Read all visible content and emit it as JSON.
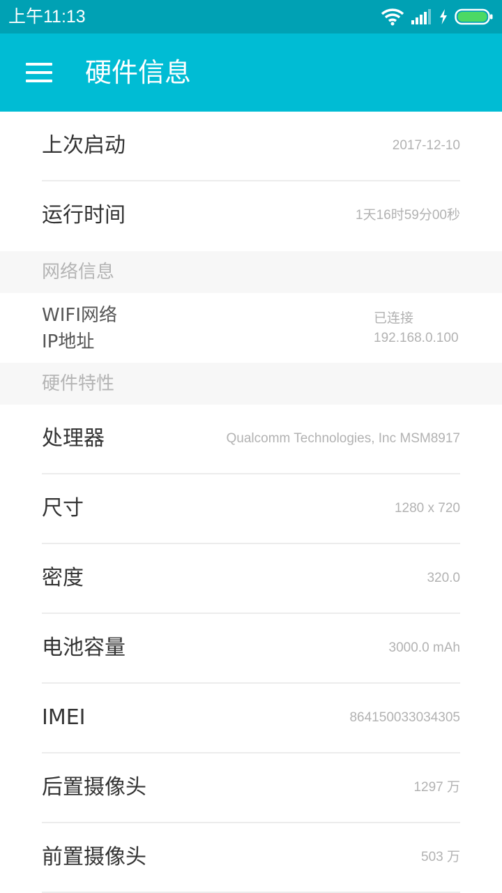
{
  "status_bar": {
    "time": "上午11:13"
  },
  "app_bar": {
    "title": "硬件信息"
  },
  "top_rows": [
    {
      "label": "上次启动",
      "value": "2017-12-10"
    },
    {
      "label": "运行时间",
      "value": "1天16时59分00秒"
    }
  ],
  "network": {
    "section_title": "网络信息",
    "wifi_label": "WIFI网络",
    "wifi_value": "已连接",
    "ip_label": "IP地址",
    "ip_value": "192.168.0.100"
  },
  "hardware": {
    "section_title": "硬件特性",
    "rows": [
      {
        "label": "处理器",
        "value": "Qualcomm Technologies, Inc MSM8917"
      },
      {
        "label": "尺寸",
        "value": "1280 x 720"
      },
      {
        "label": "密度",
        "value": "320.0"
      },
      {
        "label": "电池容量",
        "value": "3000.0 mAh"
      },
      {
        "label": "IMEI",
        "value": "864150033034305"
      },
      {
        "label": "后置摄像头",
        "value": "1297 万"
      },
      {
        "label": "前置摄像头",
        "value": "503 万"
      }
    ]
  },
  "icons": {
    "menu": "menu-icon",
    "wifi": "wifi-icon",
    "signal": "signal-icon",
    "charging": "charging-icon",
    "battery": "battery-icon"
  },
  "colors": {
    "status_bar": "#00a1b4",
    "app_bar": "#00bcd4",
    "battery": "#4cd964"
  }
}
